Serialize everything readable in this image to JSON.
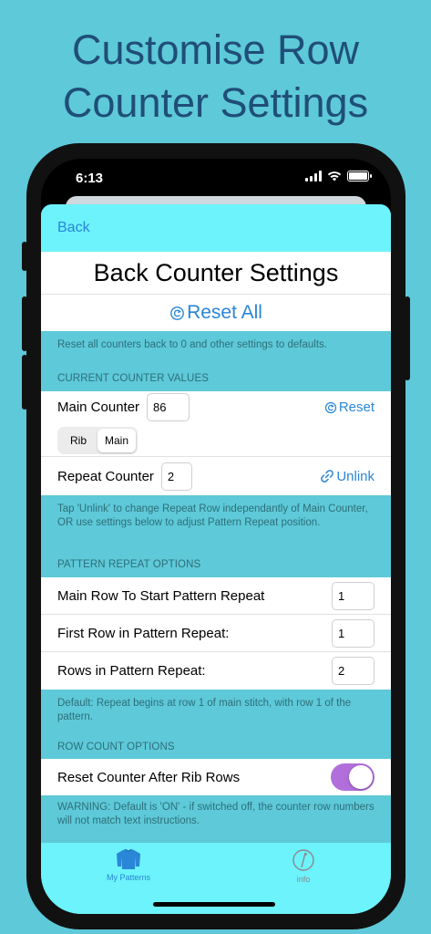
{
  "headline": {
    "line1": "Customise Row",
    "line2": "Counter Settings"
  },
  "status_bar": {
    "time": "6:13"
  },
  "nav": {
    "back_label": "Back"
  },
  "page": {
    "title": "Back Counter Settings",
    "reset_all_label": "Reset All",
    "reset_all_footnote": "Reset all counters back to 0 and other settings to defaults."
  },
  "current_values": {
    "header": "CURRENT COUNTER VALUES",
    "main_counter_label": "Main Counter",
    "main_counter_value": "86",
    "reset_label": "Reset",
    "segments": [
      "Rib",
      "Main"
    ],
    "selected_segment": "Main",
    "repeat_counter_label": "Repeat Counter",
    "repeat_counter_value": "2",
    "unlink_label": "Unlink",
    "footnote": "Tap 'Unlink' to change Repeat Row independantly of Main Counter, OR use settings below to adjust Pattern Repeat position."
  },
  "pattern_repeat": {
    "header": "PATTERN REPEAT OPTIONS",
    "rows": [
      {
        "label": "Main Row To Start Pattern Repeat",
        "value": "1"
      },
      {
        "label": "First Row in Pattern Repeat:",
        "value": "1"
      },
      {
        "label": "Rows in Pattern Repeat:",
        "value": "2"
      }
    ],
    "footnote": "Default: Repeat begins at row 1 of main stitch, with row 1 of the pattern."
  },
  "row_count": {
    "header": "ROW COUNT OPTIONS",
    "reset_after_rib_label": "Reset Counter After Rib Rows",
    "reset_after_rib_on": true,
    "warning": "WARNING: Default is 'ON' - if switched off, the counter row numbers will not match text instructions."
  },
  "tab_bar": {
    "tabs": [
      {
        "label": "My Patterns",
        "icon": "sweater-icon",
        "active": true
      },
      {
        "label": "info",
        "icon": "info-icon",
        "active": false
      }
    ]
  },
  "colors": {
    "background": "#5ec9d8",
    "headline": "#1f4e78",
    "nav_bar": "#6cf3fb",
    "link": "#2a86d6",
    "toggle_on": "#b26fdb"
  }
}
